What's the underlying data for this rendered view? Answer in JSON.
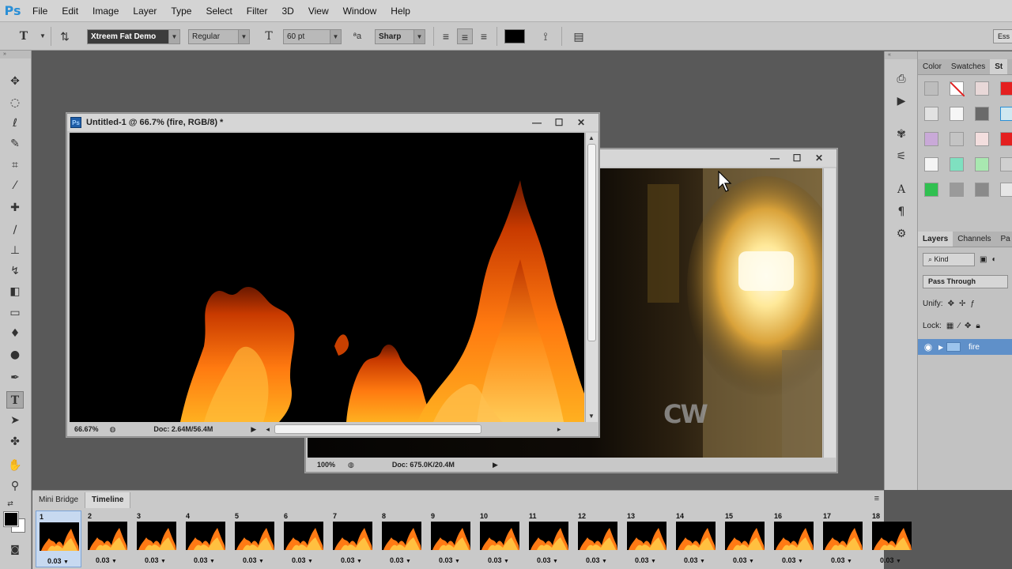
{
  "app": {
    "logo": "Ps"
  },
  "menu": [
    "File",
    "Edit",
    "Image",
    "Layer",
    "Type",
    "Select",
    "Filter",
    "3D",
    "View",
    "Window",
    "Help"
  ],
  "options": {
    "font_family": "Xtreem Fat Demo",
    "font_style": "Regular",
    "font_size": "60 pt",
    "aa_label": "a",
    "antialias": "Sharp",
    "essentials": "Ess",
    "text_color": "#000000"
  },
  "doc1": {
    "title": "Untitled-1 @ 66.7% (fire, RGB/8) *",
    "zoom": "66.67%",
    "doc_size": "Doc: 2.64M/56.4M"
  },
  "doc2": {
    "zoom": "100%",
    "doc_size": "Doc: 675.0K/20.4M",
    "watermark": "CW"
  },
  "panels": {
    "color_tabs": [
      "Color",
      "Swatches",
      "St"
    ],
    "layer_tabs": [
      "Layers",
      "Channels",
      "Pa"
    ],
    "kind": "Kind",
    "blend_mode": "Pass Through",
    "unify_label": "Unify:",
    "lock_label": "Lock:",
    "layer_name": "fire"
  },
  "timeline": {
    "tabs": [
      "Mini Bridge",
      "Timeline"
    ],
    "frames": [
      {
        "num": "1",
        "delay": "0.03"
      },
      {
        "num": "2",
        "delay": "0.03"
      },
      {
        "num": "3",
        "delay": "0.03"
      },
      {
        "num": "4",
        "delay": "0.03"
      },
      {
        "num": "5",
        "delay": "0.03"
      },
      {
        "num": "6",
        "delay": "0.03"
      },
      {
        "num": "7",
        "delay": "0.03"
      },
      {
        "num": "8",
        "delay": "0.03"
      },
      {
        "num": "9",
        "delay": "0.03"
      },
      {
        "num": "10",
        "delay": "0.03"
      },
      {
        "num": "11",
        "delay": "0.03"
      },
      {
        "num": "12",
        "delay": "0.03"
      },
      {
        "num": "13",
        "delay": "0.03"
      },
      {
        "num": "14",
        "delay": "0.03"
      },
      {
        "num": "15",
        "delay": "0.03"
      },
      {
        "num": "16",
        "delay": "0.03"
      },
      {
        "num": "17",
        "delay": "0.03"
      },
      {
        "num": "18",
        "delay": "0.03"
      }
    ]
  }
}
